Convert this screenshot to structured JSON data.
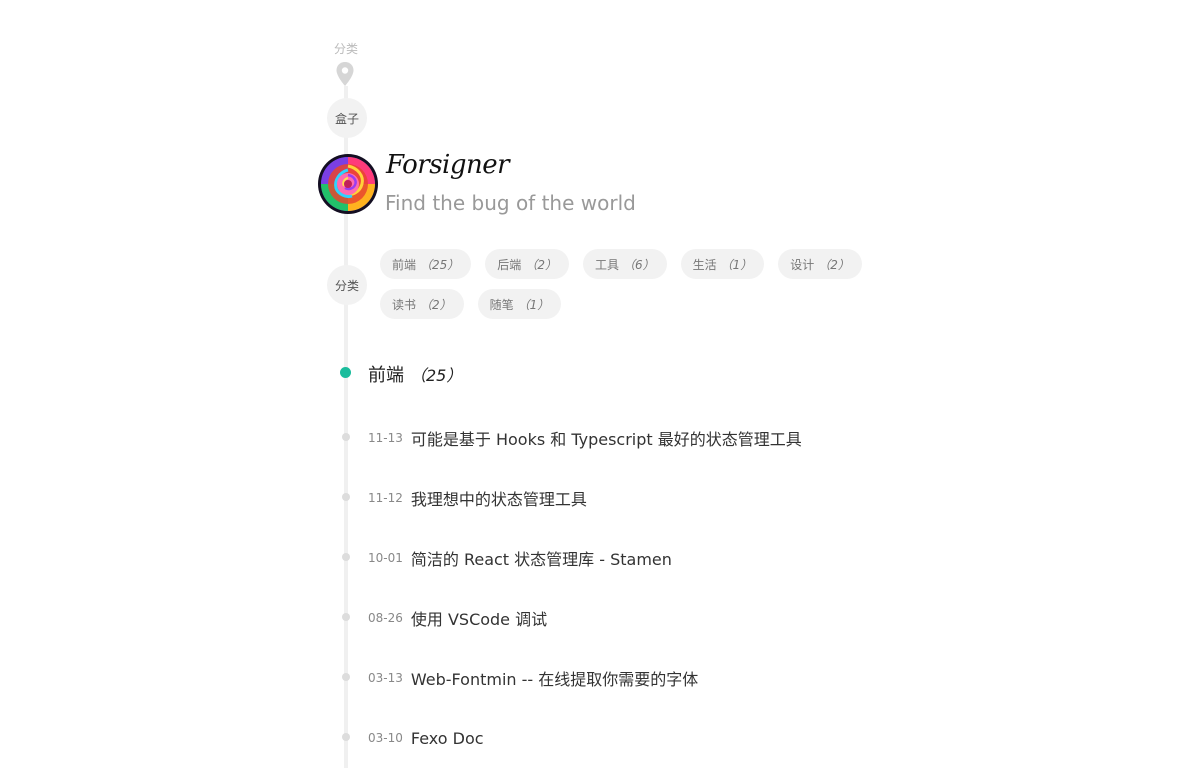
{
  "top_label": "分类",
  "box_bubble": "盒子",
  "profile": {
    "name": "Forsigner",
    "description": "Find the bug of the world"
  },
  "category_bubble": "分类",
  "tags": [
    {
      "name": "前端",
      "count": "（25）"
    },
    {
      "name": "后端",
      "count": "（2）"
    },
    {
      "name": "工具",
      "count": "（6）"
    },
    {
      "name": "生活",
      "count": "（1）"
    },
    {
      "name": "设计",
      "count": "（2）"
    },
    {
      "name": "读书",
      "count": "（2）"
    },
    {
      "name": "随笔",
      "count": "（1）"
    }
  ],
  "section": {
    "title": "前端",
    "count": "（25）"
  },
  "posts": [
    {
      "date": "11-13",
      "title": "可能是基于 Hooks 和 Typescript 最好的状态管理工具"
    },
    {
      "date": "11-12",
      "title": "我理想中的状态管理工具"
    },
    {
      "date": "10-01",
      "title": "简洁的 React 状态管理库 - Stamen"
    },
    {
      "date": "08-26",
      "title": "使用 VSCode 调试"
    },
    {
      "date": "03-13",
      "title": "Web-Fontmin -- 在线提取你需要的字体"
    },
    {
      "date": "03-10",
      "title": "Fexo Doc"
    }
  ],
  "colors": {
    "accent": "#1abc9c",
    "timeline": "#f0f0f0",
    "bubble_bg": "#f2f2f2"
  },
  "icons": {
    "pin": "map-pin-icon"
  }
}
